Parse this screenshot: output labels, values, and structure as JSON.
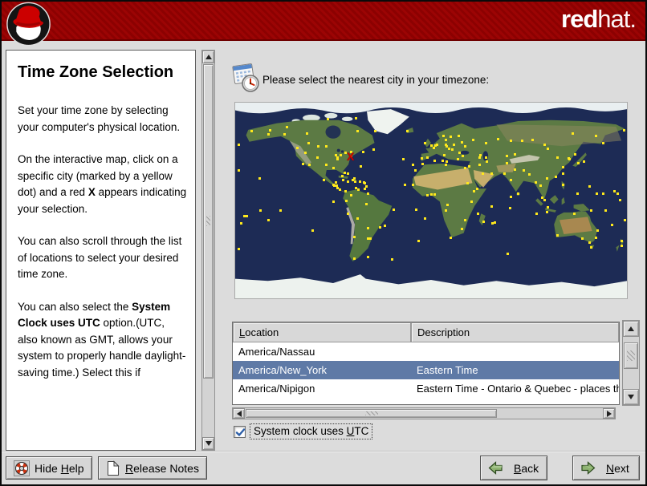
{
  "banner": {
    "brand_bold": "red",
    "brand_rest": "hat."
  },
  "help": {
    "title": "Time Zone Selection",
    "paragraphs": [
      [
        {
          "t": "Set your time zone by selecting your computer's physical location."
        }
      ],
      [
        {
          "t": "On the interactive map, click on a specific city (marked by a yellow dot) and a red "
        },
        {
          "t": "X",
          "b": true
        },
        {
          "t": " appears indicating your selection."
        }
      ],
      [
        {
          "t": "You can also scroll through the list of locations to select your desired time zone."
        }
      ],
      [
        {
          "t": "You can also select the "
        },
        {
          "t": "System Clock uses UTC",
          "b": true
        },
        {
          "t": " option.(UTC, also known as GMT, allows your system to properly handle daylight-saving time.) Select this if"
        }
      ]
    ]
  },
  "main": {
    "prompt": "Please select the nearest city in your timezone:"
  },
  "map": {
    "marker": {
      "symbol": "X",
      "lon": -74,
      "lat": 40.7
    },
    "marker_color": "#cc0000",
    "dot_color": "#ffe91c",
    "ocean_color": "#1d2b55",
    "dots": [
      [
        -150,
        61
      ],
      [
        -135,
        61
      ],
      [
        -148,
        65
      ],
      [
        -165,
        64
      ],
      [
        -177,
        52
      ],
      [
        -158,
        21
      ],
      [
        -123,
        49
      ],
      [
        -118,
        34
      ],
      [
        -112,
        33
      ],
      [
        -105,
        40
      ],
      [
        -116,
        44
      ],
      [
        -113,
        53
      ],
      [
        -104,
        50
      ],
      [
        -97,
        50
      ],
      [
        -114,
        62
      ],
      [
        -133,
        68
      ],
      [
        -95,
        75
      ],
      [
        -68,
        64
      ],
      [
        -88,
        42
      ],
      [
        -97,
        33
      ],
      [
        -90,
        30
      ],
      [
        -83,
        42
      ],
      [
        -86,
        40
      ],
      [
        -86,
        38
      ],
      [
        -74,
        41
      ],
      [
        -79,
        44
      ],
      [
        -74,
        45
      ],
      [
        -63,
        45
      ],
      [
        -53,
        47
      ],
      [
        -80,
        26
      ],
      [
        -99,
        19
      ],
      [
        -82,
        23
      ],
      [
        -90,
        15
      ],
      [
        -79,
        9
      ],
      [
        -77,
        25
      ],
      [
        -52,
        64
      ],
      [
        -69,
        76
      ],
      [
        -77,
        18
      ],
      [
        -66,
        18
      ],
      [
        -60,
        13
      ],
      [
        -61,
        11
      ],
      [
        -69,
        12
      ],
      [
        -70,
        18
      ],
      [
        -72,
        19
      ],
      [
        -61,
        16
      ],
      [
        -62,
        17
      ],
      [
        -71,
        21
      ],
      [
        -81,
        19
      ],
      [
        -88,
        17
      ],
      [
        -89,
        14
      ],
      [
        -87,
        14
      ],
      [
        -86,
        12
      ],
      [
        -84,
        10
      ],
      [
        -74,
        5
      ],
      [
        -67,
        10
      ],
      [
        -77,
        -12
      ],
      [
        -68,
        -16
      ],
      [
        -71,
        -33
      ],
      [
        -58,
        -35
      ],
      [
        -47,
        -24
      ],
      [
        -43,
        -23
      ],
      [
        -60,
        -3
      ],
      [
        -35,
        -8
      ],
      [
        -56,
        -35
      ],
      [
        -58,
        -25
      ],
      [
        -78,
        0
      ],
      [
        -58,
        7
      ],
      [
        -71,
        -53
      ],
      [
        -58,
        -52
      ],
      [
        -36,
        -54
      ],
      [
        -26,
        38
      ],
      [
        -24,
        15
      ],
      [
        -65,
        32
      ],
      [
        -6,
        -16
      ],
      [
        -14,
        -8
      ],
      [
        -12,
        -37
      ],
      [
        -22,
        64
      ],
      [
        -9,
        39
      ],
      [
        -4,
        40
      ],
      [
        -6,
        53
      ],
      [
        0,
        51
      ],
      [
        2,
        49
      ],
      [
        4,
        51
      ],
      [
        5,
        52
      ],
      [
        11,
        60
      ],
      [
        13,
        56
      ],
      [
        13,
        52
      ],
      [
        12,
        42
      ],
      [
        16,
        48
      ],
      [
        14,
        50
      ],
      [
        18,
        59
      ],
      [
        21,
        52
      ],
      [
        19,
        47
      ],
      [
        24,
        38
      ],
      [
        25,
        60
      ],
      [
        26,
        44
      ],
      [
        31,
        50
      ],
      [
        29,
        41
      ],
      [
        28,
        54
      ],
      [
        38,
        56
      ],
      [
        -17,
        33
      ],
      [
        -15,
        28
      ],
      [
        14,
        36
      ],
      [
        10,
        37
      ],
      [
        -8,
        34
      ],
      [
        3,
        37
      ],
      [
        31,
        30
      ],
      [
        -17,
        15
      ],
      [
        3,
        6
      ],
      [
        0,
        6
      ],
      [
        -4,
        5
      ],
      [
        15,
        -4
      ],
      [
        37,
        -1
      ],
      [
        39,
        9
      ],
      [
        33,
        16
      ],
      [
        28,
        -26
      ],
      [
        18,
        -34
      ],
      [
        13,
        -9
      ],
      [
        31,
        -18
      ],
      [
        48,
        -19
      ],
      [
        58,
        -20
      ],
      [
        13,
        33
      ],
      [
        35,
        32
      ],
      [
        47,
        25
      ],
      [
        55,
        25
      ],
      [
        51,
        36
      ],
      [
        44,
        33
      ],
      [
        50,
        40
      ],
      [
        45,
        42
      ],
      [
        44,
        40
      ],
      [
        69,
        35
      ],
      [
        67,
        25
      ],
      [
        69,
        41
      ],
      [
        77,
        43
      ],
      [
        77,
        29
      ],
      [
        73,
        19
      ],
      [
        80,
        7
      ],
      [
        85,
        28
      ],
      [
        90,
        24
      ],
      [
        96,
        17
      ],
      [
        100,
        14
      ],
      [
        107,
        -6
      ],
      [
        104,
        1
      ],
      [
        102,
        3
      ],
      [
        106,
        21
      ],
      [
        114,
        22
      ],
      [
        121,
        31
      ],
      [
        116,
        40
      ],
      [
        121,
        25
      ],
      [
        121,
        15
      ],
      [
        127,
        38
      ],
      [
        140,
        36
      ],
      [
        135,
        35
      ],
      [
        126,
        39
      ],
      [
        107,
        48
      ],
      [
        104,
        52
      ],
      [
        83,
        55
      ],
      [
        73,
        55
      ],
      [
        61,
        57
      ],
      [
        50,
        53
      ],
      [
        93,
        56
      ],
      [
        130,
        62
      ],
      [
        132,
        43
      ],
      [
        151,
        60
      ],
      [
        158,
        53
      ],
      [
        177,
        65
      ],
      [
        116,
        -32
      ],
      [
        131,
        -12
      ],
      [
        139,
        -35
      ],
      [
        145,
        -38
      ],
      [
        151,
        -34
      ],
      [
        153,
        -27
      ],
      [
        147,
        -43
      ],
      [
        175,
        -37
      ],
      [
        175,
        -41
      ],
      [
        178,
        -18
      ],
      [
        145,
        13
      ],
      [
        147,
        -9
      ],
      [
        166,
        -22
      ],
      [
        160,
        -9
      ],
      [
        -150,
        -18
      ],
      [
        -172,
        -14
      ],
      [
        -175,
        -21
      ],
      [
        -139,
        -9
      ],
      [
        -109,
        -27
      ],
      [
        -90,
        -1
      ],
      [
        -177,
        28
      ],
      [
        168,
        9
      ],
      [
        171,
        7
      ],
      [
        173,
        1
      ],
      [
        158,
        7
      ],
      [
        152,
        7
      ],
      [
        134,
        7
      ],
      [
        -177,
        -44
      ],
      [
        73,
        4
      ],
      [
        72,
        -7
      ],
      [
        97,
        -12
      ],
      [
        106,
        -10
      ],
      [
        70,
        -49
      ],
      [
        55,
        -5
      ],
      [
        43,
        -12
      ],
      [
        56,
        -21
      ],
      [
        42,
        11
      ],
      [
        -157,
        -9
      ],
      [
        -170,
        -14
      ]
    ]
  },
  "table": {
    "columns": [
      {
        "text": "Location",
        "mnemonic": 0
      },
      {
        "text": "Description",
        "mnemonic": -1
      }
    ],
    "rows": [
      {
        "location": "America/Nassau",
        "description": "",
        "selected": false
      },
      {
        "location": "America/New_York",
        "description": "Eastern Time",
        "selected": true
      },
      {
        "location": "America/Nipigon",
        "description": "Eastern Time - Ontario & Quebec - places th",
        "selected": false
      }
    ],
    "selected_bg": "#5f7aa6",
    "selected_fg": "#ffffff"
  },
  "utc_checkbox": {
    "text": "System clock uses UTC",
    "mnemonic": 18,
    "checked": true
  },
  "buttons": {
    "hide_help": {
      "text": "Hide Help",
      "mnemonic": 5
    },
    "release_notes": {
      "text": "Release Notes",
      "mnemonic": 0
    },
    "back": {
      "text": "Back",
      "mnemonic": 0
    },
    "next": {
      "text": "Next",
      "mnemonic": 0
    }
  },
  "colors": {
    "banner_red": "#9c0404",
    "check_blue": "#2d5fa8"
  }
}
